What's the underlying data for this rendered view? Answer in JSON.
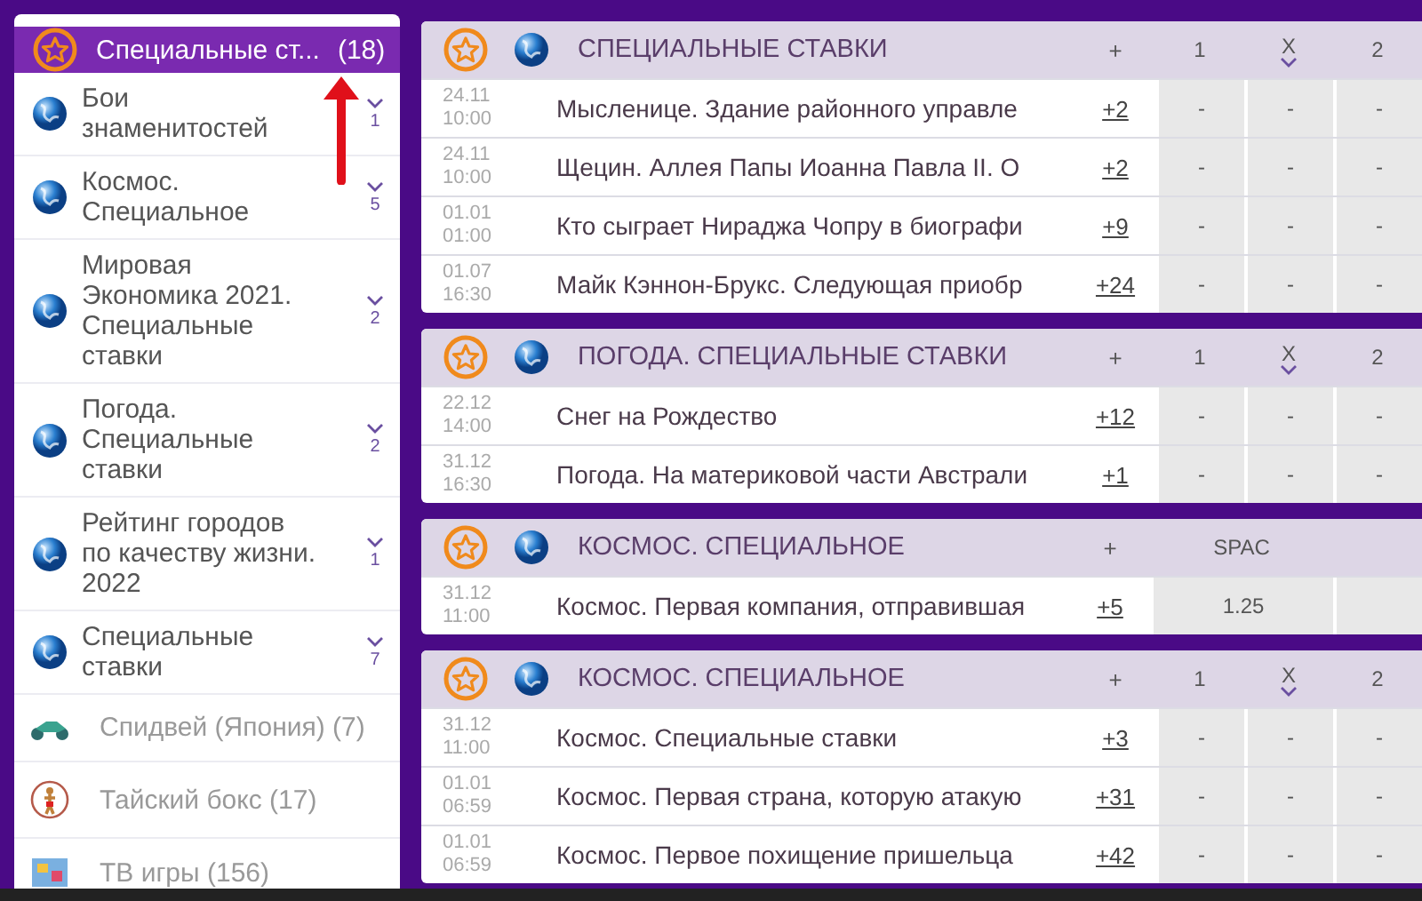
{
  "sidebar": {
    "header": {
      "label": "Специальные ст...",
      "count": "(18)",
      "selected": true
    },
    "items": [
      {
        "kind": "subcategory",
        "label": "Бои знаменитостей",
        "count": "1"
      },
      {
        "kind": "subcategory",
        "label": "Космос. Специальное",
        "count": "5"
      },
      {
        "kind": "subcategory",
        "label": "Мировая Экономика 2021. Специальные ставки",
        "count": "2"
      },
      {
        "kind": "subcategory",
        "label": "Погода. Специальные ставки",
        "count": "2"
      },
      {
        "kind": "subcategory",
        "label": "Рейтинг городов по качеству жизни. 2022",
        "count": "1"
      },
      {
        "kind": "subcategory",
        "label": "Специальные ставки",
        "count": "7"
      },
      {
        "kind": "sport",
        "label": "Спидвей (Япония) (7)"
      },
      {
        "kind": "sport",
        "label": "Тайский бокс (17)"
      },
      {
        "kind": "sport",
        "label": "ТВ игры (156)"
      }
    ]
  },
  "panels": [
    {
      "title": "СПЕЦИАЛЬНЫЕ СТАВКИ",
      "plus_header": "+",
      "columns": [
        {
          "kind": "normal",
          "label": "1"
        },
        {
          "kind": "dropdown",
          "label": "X"
        },
        {
          "kind": "normal",
          "label": "2"
        }
      ],
      "events": [
        {
          "date": "24.11",
          "time": "10:00",
          "name": "Мысленице. Здание районного управле",
          "more": "+2",
          "odds": [
            "-",
            "-",
            "-"
          ]
        },
        {
          "date": "24.11",
          "time": "10:00",
          "name": "Щецин. Аллея Папы Иоанна Павла II. О",
          "more": "+2",
          "odds": [
            "-",
            "-",
            "-"
          ]
        },
        {
          "date": "01.01",
          "time": "01:00",
          "name": "Кто сыграет Нираджа Чопру в биографи",
          "more": "+9",
          "odds": [
            "-",
            "-",
            "-"
          ]
        },
        {
          "date": "01.07",
          "time": "16:30",
          "name": "Майк Кэннон-Брукс. Следующая приобр",
          "more": "+24",
          "odds": [
            "-",
            "-",
            "-"
          ]
        }
      ]
    },
    {
      "title": "ПОГОДА. СПЕЦИАЛЬНЫЕ СТАВКИ",
      "plus_header": "+",
      "columns": [
        {
          "kind": "normal",
          "label": "1"
        },
        {
          "kind": "dropdown",
          "label": "X"
        },
        {
          "kind": "normal",
          "label": "2"
        }
      ],
      "events": [
        {
          "date": "22.12",
          "time": "14:00",
          "name": "Снег на Рождество",
          "more": "+12",
          "odds": [
            "-",
            "-",
            "-"
          ]
        },
        {
          "date": "31.12",
          "time": "16:30",
          "name": "Погода. На материковой части Австрали",
          "more": "+1",
          "odds": [
            "-",
            "-",
            "-"
          ]
        }
      ]
    },
    {
      "title": "КОСМОС. СПЕЦИАЛЬНОЕ",
      "plus_header": "+",
      "columns": [
        {
          "kind": "wide",
          "label": "SPAC"
        },
        {
          "kind": "blank"
        }
      ],
      "events": [
        {
          "date": "31.12",
          "time": "11:00",
          "name": "Космос. Первая компания, отправившая",
          "more": "+5",
          "odds": [
            "1.25"
          ]
        }
      ]
    },
    {
      "title": "КОСМОС. СПЕЦИАЛЬНОЕ",
      "plus_header": "+",
      "columns": [
        {
          "kind": "normal",
          "label": "1"
        },
        {
          "kind": "dropdown",
          "label": "X"
        },
        {
          "kind": "normal",
          "label": "2"
        }
      ],
      "events": [
        {
          "date": "31.12",
          "time": "11:00",
          "name": "Космос. Специальные ставки",
          "more": "+3",
          "odds": [
            "-",
            "-",
            "-"
          ]
        },
        {
          "date": "01.01",
          "time": "06:59",
          "name": "Космос. Первая страна, которую атакую",
          "more": "+31",
          "odds": [
            "-",
            "-",
            "-"
          ]
        },
        {
          "date": "01.01",
          "time": "06:59",
          "name": "Космос. Первое похищение пришельца",
          "more": "+42",
          "odds": [
            "-",
            "-",
            "-"
          ]
        }
      ]
    }
  ]
}
